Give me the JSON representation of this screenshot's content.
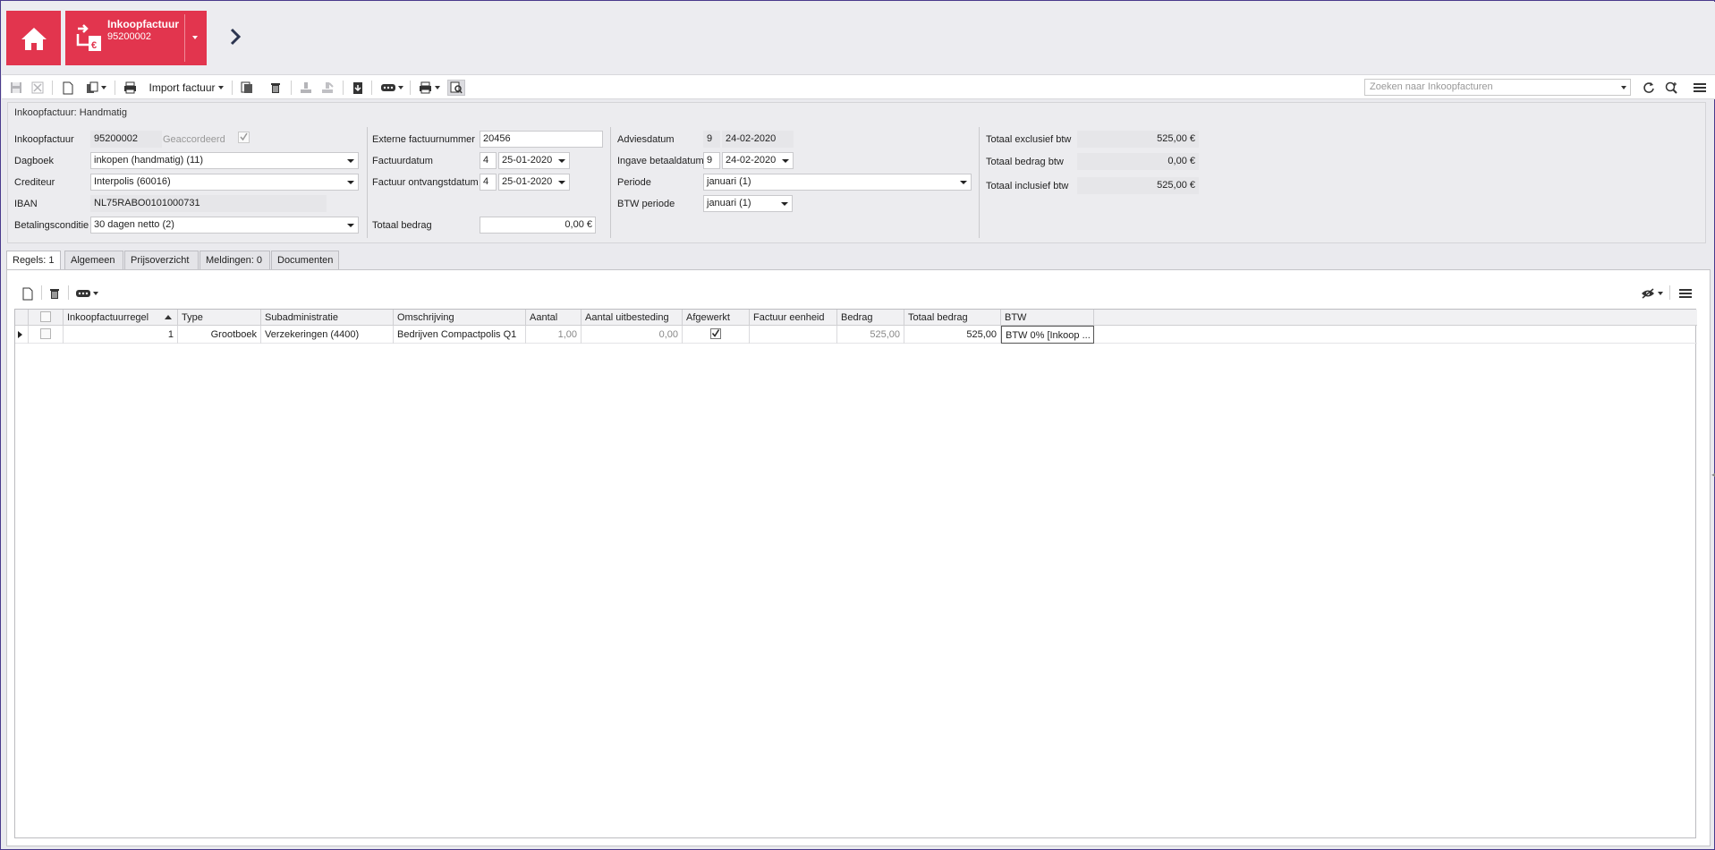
{
  "header": {
    "module_title": "Inkoopfactuur",
    "module_subtitle": "95200002"
  },
  "toolbar": {
    "import_label": "Import factuur",
    "search_placeholder": "Zoeken naar Inkoopfacturen"
  },
  "panel": {
    "title": "Inkoopfactuur: Handmatig",
    "col1": {
      "inkoopfactuur_label": "Inkoopfactuur",
      "inkoopfactuur_value": "95200002",
      "geaccordeerd_label": "Geaccordeerd",
      "geaccordeerd_checked": true,
      "dagboek_label": "Dagboek",
      "dagboek_value": "inkopen (handmatig) (11)",
      "crediteur_label": "Crediteur",
      "crediteur_value": "Interpolis (60016)",
      "iban_label": "IBAN",
      "iban_value": "NL75RABO0101000731",
      "betalingsconditie_label": "Betalingsconditie",
      "betalingsconditie_value": "30 dagen netto (2)"
    },
    "col2": {
      "extern_label": "Externe factuurnummer",
      "extern_value": "20456",
      "factuurdatum_label": "Factuurdatum",
      "factuurdatum_day": "4",
      "factuurdatum_value": "25-01-2020",
      "ontvangst_label": "Factuur ontvangstdatum",
      "ontvangst_day": "4",
      "ontvangst_value": "25-01-2020",
      "totaal_label": "Totaal bedrag",
      "totaal_value": "0,00 €"
    },
    "col3": {
      "advies_label": "Adviesdatum",
      "advies_day": "9",
      "advies_value": "24-02-2020",
      "ingave_label": "Ingave betaaldatum",
      "ingave_day": "9",
      "ingave_value": "24-02-2020",
      "periode_label": "Periode",
      "periode_value": "januari (1)",
      "btwperiode_label": "BTW periode",
      "btwperiode_value": "januari (1)"
    },
    "col4": {
      "excl_label": "Totaal exclusief btw",
      "excl_value": "525,00 €",
      "btw_label": "Totaal bedrag btw",
      "btw_value": "0,00 €",
      "incl_label": "Totaal inclusief btw",
      "incl_value": "525,00 €"
    }
  },
  "tabs": [
    {
      "label": "Regels: 1",
      "active": true
    },
    {
      "label": "Algemeen"
    },
    {
      "label": "Prijsoverzicht"
    },
    {
      "label": "Meldingen: 0"
    },
    {
      "label": "Documenten"
    }
  ],
  "grid": {
    "columns": [
      "Inkoopfactuurregel",
      "Type",
      "Subadministratie",
      "Omschrijving",
      "Aantal",
      "Aantal uitbesteding",
      "Afgewerkt",
      "Factuur eenheid",
      "Bedrag",
      "Totaal bedrag",
      "BTW"
    ],
    "rows": [
      {
        "regel": "1",
        "type": "Grootboek",
        "subadministratie": "Verzekeringen (4400)",
        "omschrijving": "Bedrijven Compactpolis Q1",
        "aantal": "1,00",
        "aantal_uitbesteding": "0,00",
        "afgewerkt": true,
        "factuur_eenheid": "",
        "bedrag": "525,00",
        "totaal_bedrag": "525,00",
        "btw": "BTW 0% [Inkoop ..."
      }
    ]
  },
  "colors": {
    "accent": "#e2354e",
    "panel_bg": "#ececef"
  }
}
